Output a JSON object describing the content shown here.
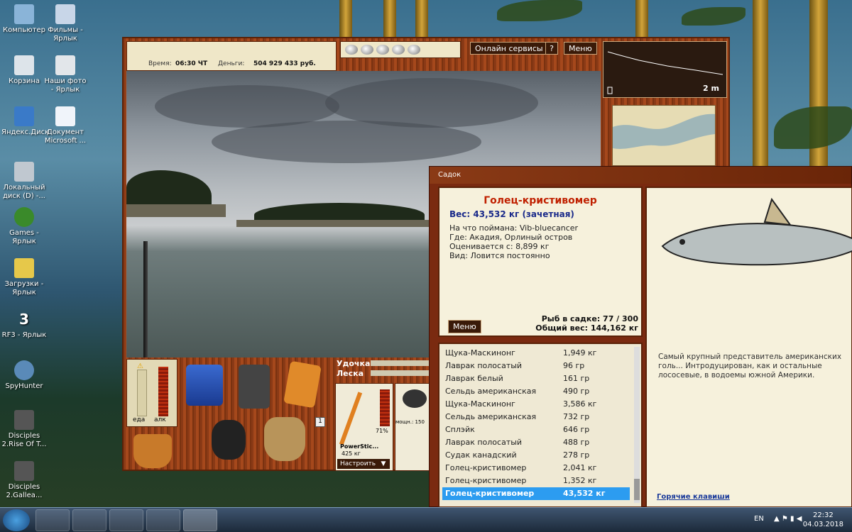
{
  "desktop": {
    "icons": [
      {
        "label": "Компьютер"
      },
      {
        "label": "Фильмы - Ярлык"
      },
      {
        "label": "Корзина"
      },
      {
        "label": "Наши фото - Ярлык"
      },
      {
        "label": "Яндекс.Диск"
      },
      {
        "label": "Документ Microsoft ..."
      },
      {
        "label": "Локальный диск (D) -..."
      },
      {
        "label": "Games - Ярлык"
      },
      {
        "label": "Загрузки - Ярлык"
      },
      {
        "label": "RF3 - Ярлык"
      },
      {
        "label": "SpyHunter"
      },
      {
        "label": "Disciples 2.Rise Of T..."
      },
      {
        "label": "Disciples 2.Gallea..."
      }
    ]
  },
  "game": {
    "time_label": "Время:",
    "time_value": "06:30 ЧТ",
    "money_label": "Деньги:",
    "money_value": "504 929 433 руб.",
    "online_btn": "Онлайн сервисы",
    "help_btn": "?",
    "menu_btn": "Меню",
    "depth": "2 m",
    "bait_label": "Удочка",
    "line_label": "Леска",
    "food_label": "еда",
    "alc_label": "алк",
    "rod_name": "PowerStic...",
    "rod_weight": "425 кг",
    "rod_pct": "71%",
    "reel_power": "мощн.: 150",
    "setup_btn": "Настроить",
    "slot_number": "1"
  },
  "cage": {
    "title": "Садок",
    "fish_name": "Голец-кристивомер",
    "weight": "Вес: 43,532 кг (зачетная)",
    "caught_on": "На что поймана: Vib-bluecancer",
    "where": "Где: Акадия, Орлиный остров",
    "rated_from": "Оценивается с: 8,899 кг",
    "type": "Вид: Ловится постоянно",
    "menu_btn": "Меню",
    "fish_count": "Рыб в садке: 77 / 300",
    "total_weight": "Общий вес: 144,162 кг",
    "description": "Самый крупный представитель американских голь... Интродуцирован, как и остальные лососевые, в водоемы южной Америки.",
    "hotkeys": "Горячие клавиши",
    "rows": [
      {
        "name": "Щука-Маскинонг",
        "weight": "1,949 кг"
      },
      {
        "name": "Лаврак полосатый",
        "weight": "96 гр"
      },
      {
        "name": "Лаврак белый",
        "weight": "161 гр"
      },
      {
        "name": "Сельдь американская",
        "weight": "490 гр"
      },
      {
        "name": "Щука-Маскинонг",
        "weight": "3,586 кг"
      },
      {
        "name": "Сельдь американская",
        "weight": "732 гр"
      },
      {
        "name": "Сплэйк",
        "weight": "646 гр"
      },
      {
        "name": "Лаврак полосатый",
        "weight": "488 гр"
      },
      {
        "name": "Судак канадский",
        "weight": "278 гр"
      },
      {
        "name": "Голец-кристивомер",
        "weight": "2,041 кг"
      },
      {
        "name": "Голец-кристивомер",
        "weight": "1,352 кг"
      },
      {
        "name": "Голец-кристивомер",
        "weight": "43,532 кг"
      }
    ]
  },
  "taskbar": {
    "lang": "EN",
    "time": "22:32",
    "date": "04.03.2018"
  }
}
